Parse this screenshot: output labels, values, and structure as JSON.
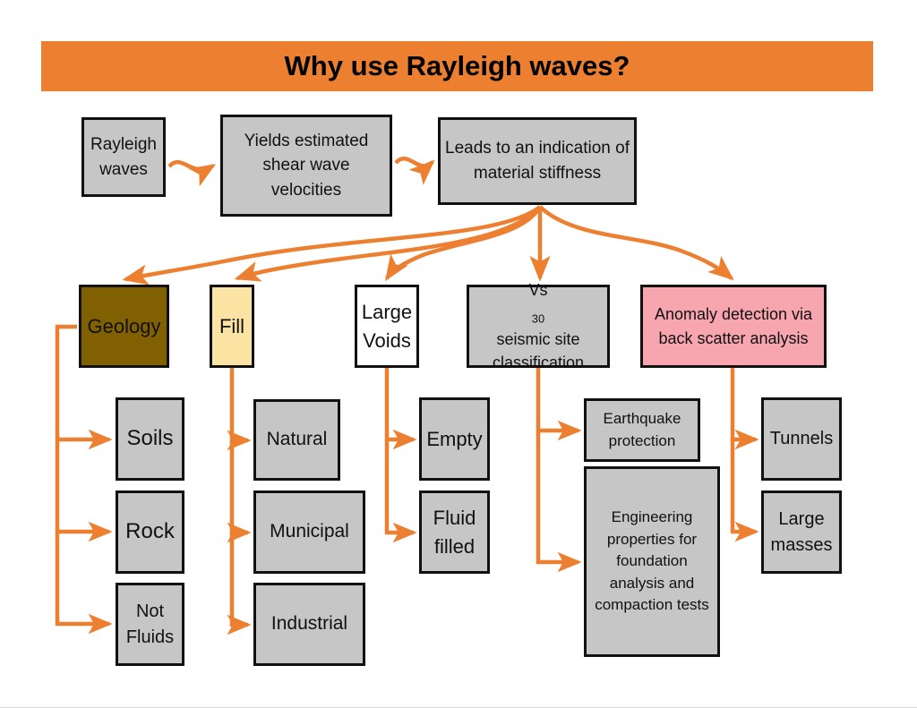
{
  "slide": {
    "banner": {
      "title": "Why use Rayleigh waves?",
      "background_color": "#EC8030"
    },
    "accent_color": "#EC8030",
    "default_node_fill": "#C6C6C6",
    "node_border_color": "#111111"
  },
  "nodes": {
    "rayleigh_waves": {
      "label": "Rayleigh waves",
      "fill": "#C6C6C6"
    },
    "yields_estimated": {
      "label": "Yields estimated shear wave velocities",
      "fill": "#C6C6C6"
    },
    "leads_to_indication": {
      "label": "Leads to an indication of material stiffness",
      "fill": "#C6C6C6"
    },
    "geology": {
      "label": "Geology",
      "fill": "#806000"
    },
    "fill": {
      "label": "Fill",
      "fill": "#FBE3A4"
    },
    "large_voids": {
      "label": "Large Voids",
      "fill": "#FFFFFF"
    },
    "vs30": {
      "label_prefix": "Vs",
      "label_sub": "30",
      "label_suffix": " seismic site classification",
      "fill": "#C6C6C6"
    },
    "anomaly_detection": {
      "label": "Anomaly detection via back scatter analysis",
      "fill": "#F7A6B0"
    },
    "soils": {
      "label": "Soils",
      "fill": "#C6C6C6"
    },
    "rock": {
      "label": "Rock",
      "fill": "#C6C6C6"
    },
    "not_fluids": {
      "label": "Not Fluids",
      "fill": "#C6C6C6"
    },
    "natural": {
      "label": "Natural",
      "fill": "#C6C6C6"
    },
    "municipal": {
      "label": "Municipal",
      "fill": "#C6C6C6"
    },
    "industrial": {
      "label": "Industrial",
      "fill": "#C6C6C6"
    },
    "empty": {
      "label": "Empty",
      "fill": "#C6C6C6"
    },
    "fluid_filled": {
      "label": "Fluid filled",
      "fill": "#C6C6C6"
    },
    "earthquake_protection": {
      "label": "Earthquake protection",
      "fill": "#C6C6C6"
    },
    "engineering_properties": {
      "label": "Engineering properties for foundation analysis and compaction tests",
      "fill": "#C6C6C6"
    },
    "tunnels": {
      "label": "Tunnels",
      "fill": "#C6C6C6"
    },
    "large_masses": {
      "label": "Large masses",
      "fill": "#C6C6C6"
    }
  },
  "connections": [
    {
      "from": "rayleigh_waves",
      "to": "yields_estimated"
    },
    {
      "from": "yields_estimated",
      "to": "leads_to_indication"
    },
    {
      "from": "leads_to_indication",
      "to": "geology"
    },
    {
      "from": "leads_to_indication",
      "to": "fill"
    },
    {
      "from": "leads_to_indication",
      "to": "large_voids"
    },
    {
      "from": "leads_to_indication",
      "to": "vs30"
    },
    {
      "from": "leads_to_indication",
      "to": "anomaly_detection"
    },
    {
      "from": "geology",
      "to": "soils"
    },
    {
      "from": "geology",
      "to": "rock"
    },
    {
      "from": "geology",
      "to": "not_fluids"
    },
    {
      "from": "fill",
      "to": "natural"
    },
    {
      "from": "fill",
      "to": "municipal"
    },
    {
      "from": "fill",
      "to": "industrial"
    },
    {
      "from": "large_voids",
      "to": "empty"
    },
    {
      "from": "large_voids",
      "to": "fluid_filled"
    },
    {
      "from": "vs30",
      "to": "earthquake_protection"
    },
    {
      "from": "vs30",
      "to": "engineering_properties"
    },
    {
      "from": "anomaly_detection",
      "to": "tunnels"
    },
    {
      "from": "anomaly_detection",
      "to": "large_masses"
    }
  ]
}
